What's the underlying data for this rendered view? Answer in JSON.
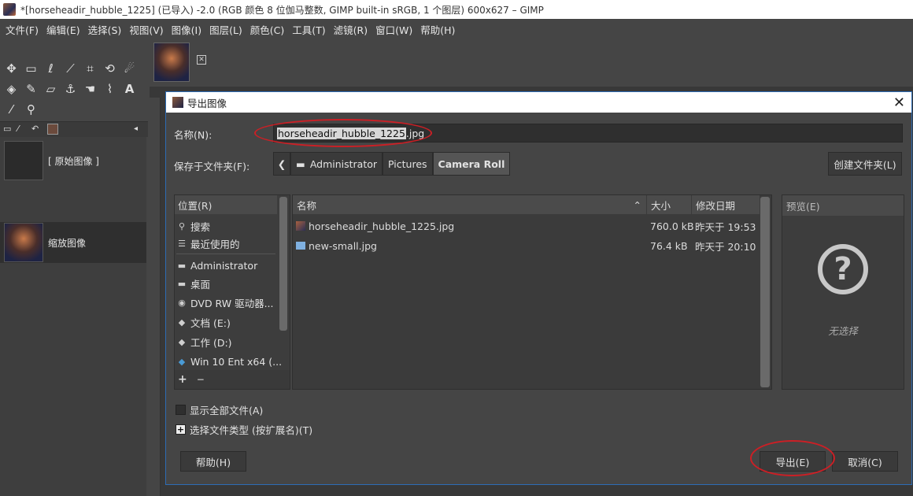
{
  "window": {
    "title": "*[horseheadir_hubble_1225] (已导入) -2.0 (RGB 颜色 8 位伽马整数, GIMP built-in sRGB, 1 个图层) 600x627 – GIMP"
  },
  "menubar": {
    "items": [
      "文件(F)",
      "编辑(E)",
      "选择(S)",
      "视图(V)",
      "图像(I)",
      "图层(L)",
      "颜色(C)",
      "工具(T)",
      "滤镜(R)",
      "窗口(W)",
      "帮助(H)"
    ]
  },
  "history": {
    "items": [
      {
        "label": "[ 原始图像 ]"
      },
      {
        "label": "缩放图像"
      }
    ]
  },
  "dialog": {
    "title": "导出图像",
    "name_label": "名称(N):",
    "filename_selected": "horseheadir_hubble_1225",
    "filename_ext": ".jpg",
    "save_in_label": "保存于文件夹(F):",
    "path": [
      "Administrator",
      "Pictures",
      "Camera Roll"
    ],
    "new_folder_label": "创建文件夹(L)",
    "places": {
      "header": "位置(R)",
      "items": [
        {
          "icon": "search-icon",
          "label": "搜索"
        },
        {
          "icon": "recent-icon",
          "label": "最近使用的"
        },
        {
          "icon": "folder-icon",
          "label": "Administrator"
        },
        {
          "icon": "folder-icon",
          "label": "桌面"
        },
        {
          "icon": "drive-icon",
          "label": "DVD RW 驱动器..."
        },
        {
          "icon": "drive-icon",
          "label": "文档 (E:)"
        },
        {
          "icon": "drive-icon",
          "label": "工作 (D:)"
        },
        {
          "icon": "drive-icon",
          "label": "Win 10 Ent x64 (..."
        }
      ],
      "add": "+",
      "remove": "−"
    },
    "files": {
      "col_name": "名称",
      "col_size": "大小",
      "col_date": "修改日期",
      "rows": [
        {
          "name": "horseheadir_hubble_1225.jpg",
          "size": "760.0 kB",
          "date": "昨天于 19:53"
        },
        {
          "name": "new-small.jpg",
          "size": "76.4 kB",
          "date": "昨天于 20:10"
        }
      ]
    },
    "preview": {
      "header": "预览(E)",
      "none": "无选择"
    },
    "show_all_label": "显示全部文件(A)",
    "file_type_label": "选择文件类型 (按扩展名)(T)",
    "help_label": "帮助(H)",
    "export_label": "导出(E)",
    "cancel_label": "取消(C)"
  }
}
